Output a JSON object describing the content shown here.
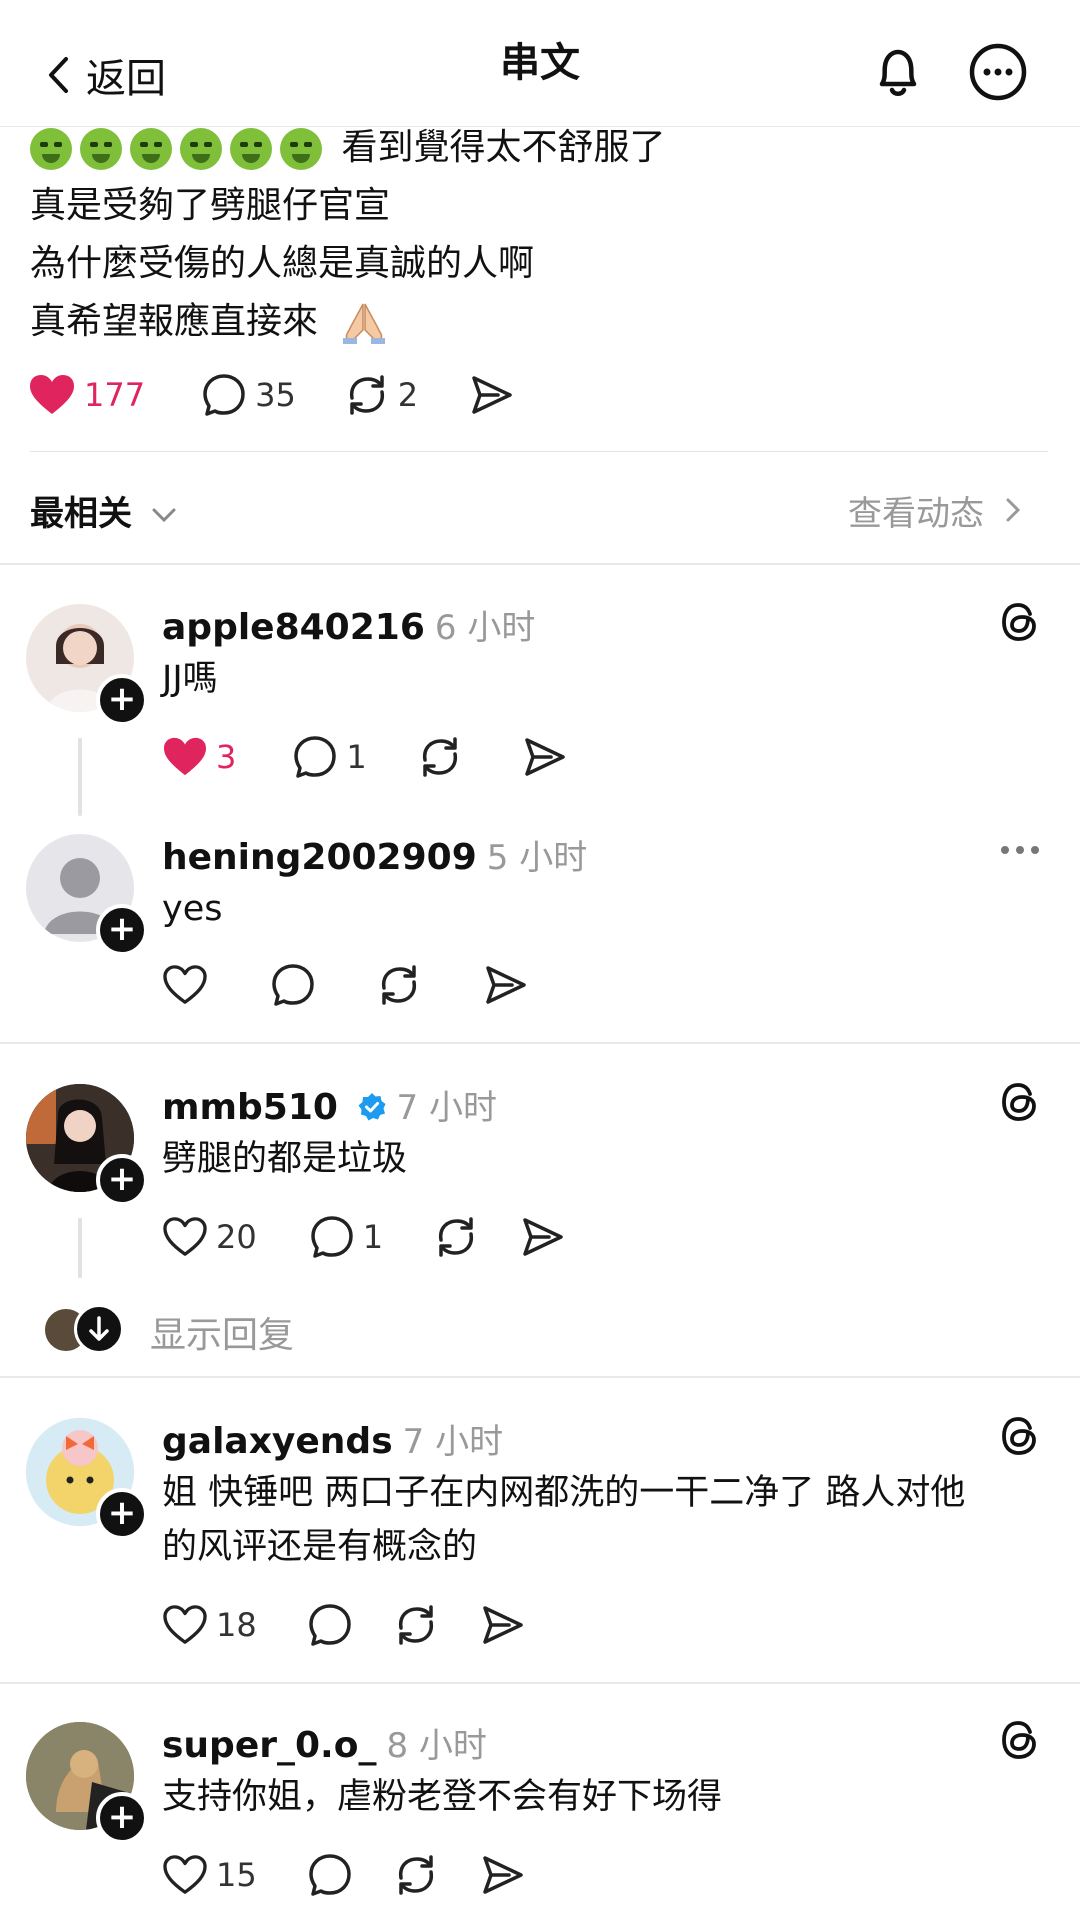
{
  "header": {
    "back_label": "返回",
    "title": "串文"
  },
  "post": {
    "lines": [
      "看到覺得太不舒服了",
      "真是受夠了劈腿仔官宣",
      "為什麼受傷的人總是真誠的人啊",
      "真希望報應直接來"
    ],
    "likes": "177",
    "comments": "35",
    "reposts": "2"
  },
  "sort": {
    "label": "最相关",
    "activity_label": "查看动态"
  },
  "comments": [
    {
      "user": "apple840216",
      "time": "6 小时",
      "text": "JJ嗎",
      "likes": "3",
      "replies": "1"
    },
    {
      "user": "hening2002909",
      "time": "5 小时",
      "text": "yes"
    },
    {
      "user": "mmb510",
      "time": "7 小时",
      "text": "劈腿的都是垃圾",
      "likes": "20",
      "replies": "1"
    },
    {
      "user": "galaxyends",
      "time": "7 小时",
      "text_line1": "姐 快锤吧 两口子在内网都洗的一干二净了 路人对他",
      "text_line2": "的风评还是有概念的",
      "likes": "18"
    },
    {
      "user": "super_0.o_",
      "time": "8 小时",
      "text": "支持你姐，虐粉老登不会有好下场得",
      "likes": "15"
    }
  ],
  "show_replies_label": "显示回复",
  "colors": {
    "like_red": "#e0245e",
    "verified_blue": "#1d9bf0"
  }
}
